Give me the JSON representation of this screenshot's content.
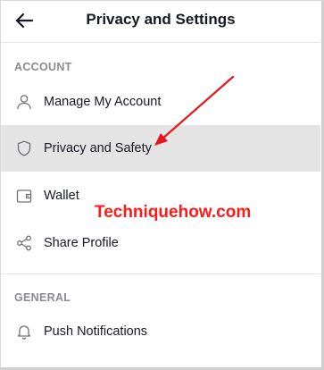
{
  "header": {
    "title": "Privacy and Settings"
  },
  "sections": {
    "account": {
      "heading": "ACCOUNT",
      "items": [
        {
          "label": "Manage My Account",
          "icon": "person-icon"
        },
        {
          "label": "Privacy and Safety",
          "icon": "shield-icon",
          "selected": true
        },
        {
          "label": "Wallet",
          "icon": "wallet-icon"
        },
        {
          "label": "Share Profile",
          "icon": "share-icon"
        }
      ]
    },
    "general": {
      "heading": "GENERAL",
      "items": [
        {
          "label": "Push Notifications",
          "icon": "bell-icon"
        }
      ]
    }
  },
  "annotation": {
    "watermark": "Techniquehow.com",
    "arrow_color": "#e8141b"
  },
  "colors": {
    "selected_row": "#e4e4e5",
    "section_heading": "#8a8b91",
    "text": "#161823"
  }
}
